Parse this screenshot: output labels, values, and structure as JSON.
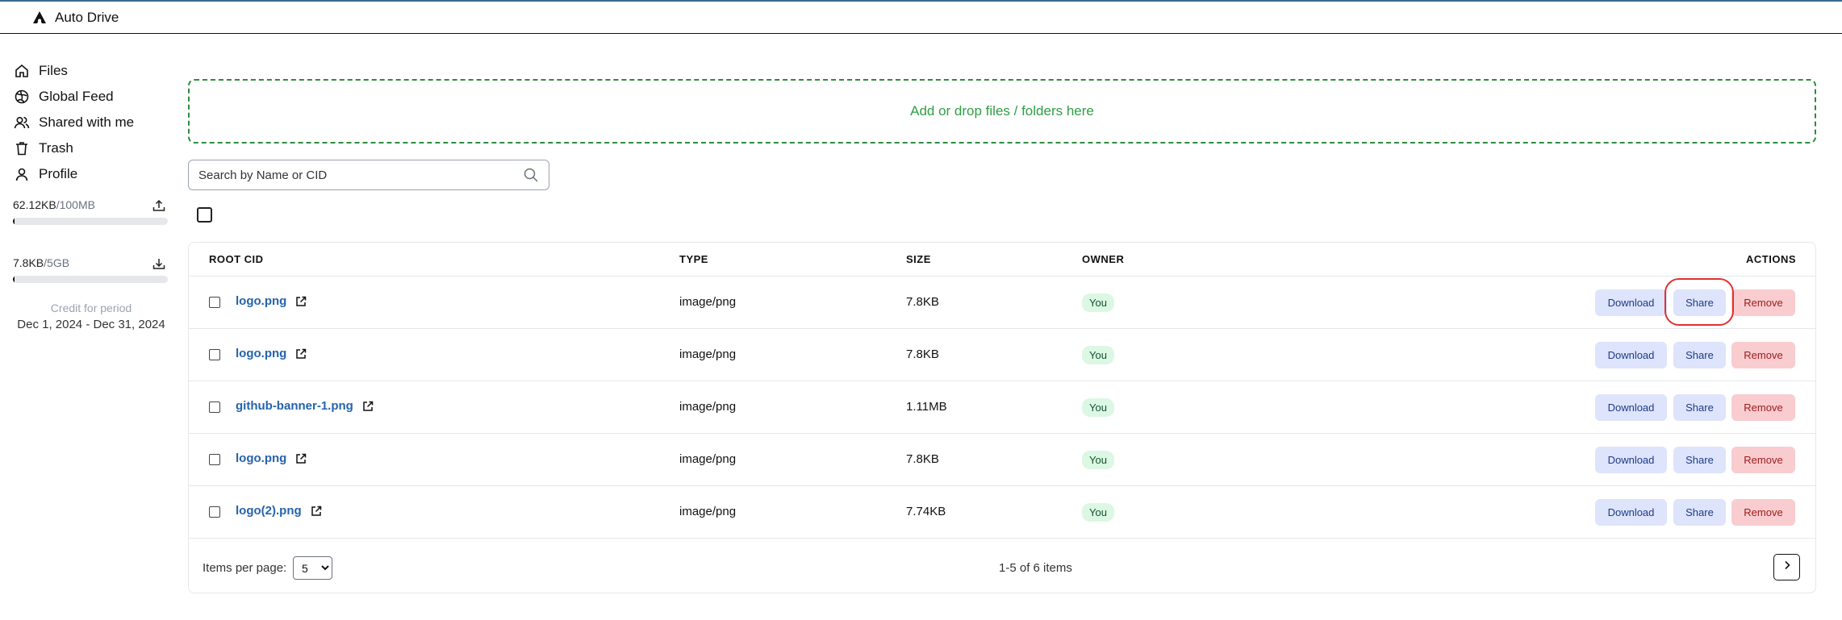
{
  "app": {
    "title": "Auto Drive"
  },
  "sidebar": {
    "items": [
      {
        "label": "Files",
        "icon": "home-icon"
      },
      {
        "label": "Global Feed",
        "icon": "globe-icon"
      },
      {
        "label": "Shared with me",
        "icon": "users-icon"
      },
      {
        "label": "Trash",
        "icon": "trash-icon"
      },
      {
        "label": "Profile",
        "icon": "user-icon"
      }
    ],
    "upload_quota": {
      "used": "62.12KB",
      "limit": "/100MB",
      "fraction": 0.0006
    },
    "download_quota": {
      "used": "7.8KB",
      "limit": "/5GB",
      "fraction": 1.5e-06
    },
    "credit_label": "Credit for period",
    "credit_period": "Dec 1, 2024 - Dec 31, 2024"
  },
  "dropzone": {
    "label": "Add or drop files / folders here"
  },
  "search": {
    "placeholder": "Search by Name or CID"
  },
  "table": {
    "headers": {
      "root_cid": "ROOT CID",
      "type": "TYPE",
      "size": "SIZE",
      "owner": "OWNER",
      "actions": "ACTIONS"
    },
    "rows": [
      {
        "name": "logo.png",
        "type": "image/png",
        "size": "7.8KB",
        "owner": "You"
      },
      {
        "name": "logo.png",
        "type": "image/png",
        "size": "7.8KB",
        "owner": "You"
      },
      {
        "name": "github-banner-1.png",
        "type": "image/png",
        "size": "1.11MB",
        "owner": "You"
      },
      {
        "name": "logo.png",
        "type": "image/png",
        "size": "7.8KB",
        "owner": "You"
      },
      {
        "name": "logo(2).png",
        "type": "image/png",
        "size": "7.74KB",
        "owner": "You"
      }
    ],
    "actions": {
      "download": "Download",
      "share": "Share",
      "remove": "Remove"
    }
  },
  "pagination": {
    "items_per_page_label": "Items per page:",
    "items_per_page": "5",
    "range": "1-5 of 6 items"
  },
  "colors": {
    "accent_green": "#2f9e44",
    "link_blue": "#2563ae",
    "highlight_red": "#e03131"
  }
}
